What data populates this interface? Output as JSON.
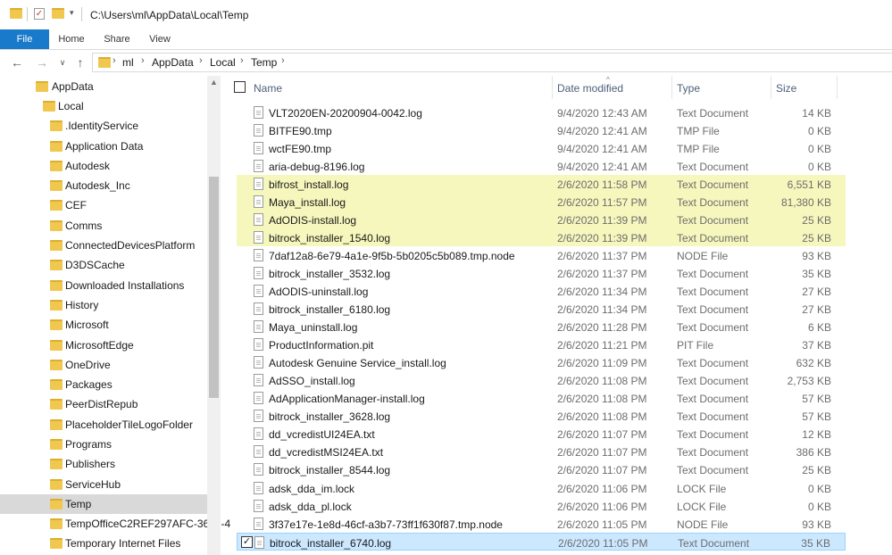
{
  "window": {
    "path": "C:\\Users\\ml\\AppData\\Local\\Temp"
  },
  "ribbon": {
    "tabs": [
      "File",
      "Home",
      "Share",
      "View"
    ]
  },
  "breadcrumb": [
    "ml",
    "AppData",
    "Local",
    "Temp"
  ],
  "nav_items": [
    {
      "label": "AppData",
      "level": 0
    },
    {
      "label": "Local",
      "level": 1
    },
    {
      "label": ".IdentityService",
      "level": 2
    },
    {
      "label": "Application Data",
      "level": 2,
      "icon": "shortcut-folder-icon"
    },
    {
      "label": "Autodesk",
      "level": 2
    },
    {
      "label": "Autodesk_Inc",
      "level": 2
    },
    {
      "label": "CEF",
      "level": 2
    },
    {
      "label": "Comms",
      "level": 2
    },
    {
      "label": "ConnectedDevicesPlatform",
      "level": 2
    },
    {
      "label": "D3DSCache",
      "level": 2
    },
    {
      "label": "Downloaded Installations",
      "level": 2
    },
    {
      "label": "History",
      "level": 2,
      "icon": "shortcut-folder-icon"
    },
    {
      "label": "Microsoft",
      "level": 2
    },
    {
      "label": "MicrosoftEdge",
      "level": 2
    },
    {
      "label": "OneDrive",
      "level": 2
    },
    {
      "label": "Packages",
      "level": 2
    },
    {
      "label": "PeerDistRepub",
      "level": 2
    },
    {
      "label": "PlaceholderTileLogoFolder",
      "level": 2
    },
    {
      "label": "Programs",
      "level": 2
    },
    {
      "label": "Publishers",
      "level": 2
    },
    {
      "label": "ServiceHub",
      "level": 2
    },
    {
      "label": "Temp",
      "level": 2,
      "selected": true
    },
    {
      "label": "TempOfficeC2REF297AFC-3658-4",
      "level": 2
    },
    {
      "label": "Temporary Internet Files",
      "level": 2,
      "icon": "shortcut-folder-icon"
    }
  ],
  "columns": {
    "name": "Name",
    "date": "Date modified",
    "type": "Type",
    "size": "Size"
  },
  "files": [
    {
      "name": "VLT2020EN-20200904-0042.log",
      "date": "9/4/2020 12:43 AM",
      "type": "Text Document",
      "size": "14 KB"
    },
    {
      "name": "BITFE90.tmp",
      "date": "9/4/2020 12:41 AM",
      "type": "TMP File",
      "size": "0 KB"
    },
    {
      "name": "wctFE90.tmp",
      "date": "9/4/2020 12:41 AM",
      "type": "TMP File",
      "size": "0 KB"
    },
    {
      "name": "aria-debug-8196.log",
      "date": "9/4/2020 12:41 AM",
      "type": "Text Document",
      "size": "0 KB"
    },
    {
      "name": "bifrost_install.log",
      "date": "2/6/2020 11:58 PM",
      "type": "Text Document",
      "size": "6,551 KB",
      "highlight": true
    },
    {
      "name": "Maya_install.log",
      "date": "2/6/2020 11:57 PM",
      "type": "Text Document",
      "size": "81,380 KB",
      "highlight": true
    },
    {
      "name": "AdODIS-install.log",
      "date": "2/6/2020 11:39 PM",
      "type": "Text Document",
      "size": "25 KB",
      "highlight": true
    },
    {
      "name": "bitrock_installer_1540.log",
      "date": "2/6/2020 11:39 PM",
      "type": "Text Document",
      "size": "25 KB",
      "highlight": true
    },
    {
      "name": "7daf12a8-6e79-4a1e-9f5b-5b0205c5b089.tmp.node",
      "date": "2/6/2020 11:37 PM",
      "type": "NODE File",
      "size": "93 KB"
    },
    {
      "name": "bitrock_installer_3532.log",
      "date": "2/6/2020 11:37 PM",
      "type": "Text Document",
      "size": "35 KB"
    },
    {
      "name": "AdODIS-uninstall.log",
      "date": "2/6/2020 11:34 PM",
      "type": "Text Document",
      "size": "27 KB"
    },
    {
      "name": "bitrock_installer_6180.log",
      "date": "2/6/2020 11:34 PM",
      "type": "Text Document",
      "size": "27 KB"
    },
    {
      "name": "Maya_uninstall.log",
      "date": "2/6/2020 11:28 PM",
      "type": "Text Document",
      "size": "6 KB"
    },
    {
      "name": "ProductInformation.pit",
      "date": "2/6/2020 11:21 PM",
      "type": "PIT File",
      "size": "37 KB"
    },
    {
      "name": "Autodesk Genuine Service_install.log",
      "date": "2/6/2020 11:09 PM",
      "type": "Text Document",
      "size": "632 KB"
    },
    {
      "name": "AdSSO_install.log",
      "date": "2/6/2020 11:08 PM",
      "type": "Text Document",
      "size": "2,753 KB"
    },
    {
      "name": "AdApplicationManager-install.log",
      "date": "2/6/2020 11:08 PM",
      "type": "Text Document",
      "size": "57 KB"
    },
    {
      "name": "bitrock_installer_3628.log",
      "date": "2/6/2020 11:08 PM",
      "type": "Text Document",
      "size": "57 KB"
    },
    {
      "name": "dd_vcredistUI24EA.txt",
      "date": "2/6/2020 11:07 PM",
      "type": "Text Document",
      "size": "12 KB"
    },
    {
      "name": "dd_vcredistMSI24EA.txt",
      "date": "2/6/2020 11:07 PM",
      "type": "Text Document",
      "size": "386 KB"
    },
    {
      "name": "bitrock_installer_8544.log",
      "date": "2/6/2020 11:07 PM",
      "type": "Text Document",
      "size": "25 KB"
    },
    {
      "name": "adsk_dda_im.lock",
      "date": "2/6/2020 11:06 PM",
      "type": "LOCK File",
      "size": "0 KB"
    },
    {
      "name": "adsk_dda_pl.lock",
      "date": "2/6/2020 11:06 PM",
      "type": "LOCK File",
      "size": "0 KB"
    },
    {
      "name": "3f37e17e-1e8d-46cf-a3b7-73ff1f630f87.tmp.node",
      "date": "2/6/2020 11:05 PM",
      "type": "NODE File",
      "size": "93 KB"
    },
    {
      "name": "bitrock_installer_6740.log",
      "date": "2/6/2020 11:05 PM",
      "type": "Text Document",
      "size": "35 KB",
      "selected": true
    }
  ],
  "colors": {
    "accent": "#1979ca",
    "highlight": "#f6f7bd",
    "selection": "#cce8ff",
    "nav_selection": "#d9d9d9"
  }
}
